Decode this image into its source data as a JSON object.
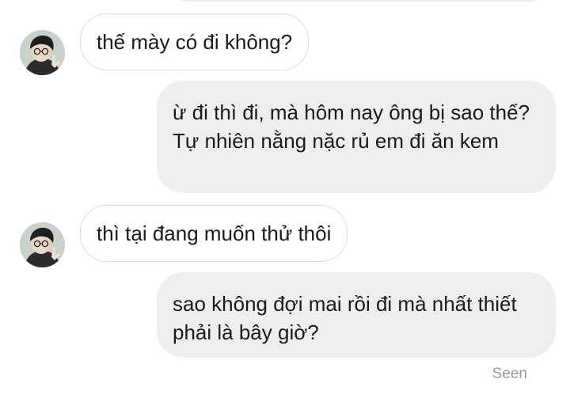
{
  "messages": [
    {
      "direction": "incoming",
      "text": "thế mày có đi không?"
    },
    {
      "direction": "outgoing",
      "text": "ừ đi thì đi, mà hôm nay ông bị sao thế? Tự nhiên nằng nặc rủ em đi ăn kem"
    },
    {
      "direction": "incoming",
      "text": "thì tại đang muốn thử thôi"
    },
    {
      "direction": "outgoing",
      "text": "sao không đợi mai rồi đi mà nhất thiết phải là bây giờ?"
    }
  ],
  "status": {
    "seen_label": "Seen"
  },
  "colors": {
    "outgoing_bubble": "#eeeeee",
    "incoming_bubble": "#ffffff",
    "incoming_border": "#dcdcdc",
    "seen_text": "#9a9a9a"
  },
  "icons": {
    "contact_avatar": "avatar-photo"
  }
}
